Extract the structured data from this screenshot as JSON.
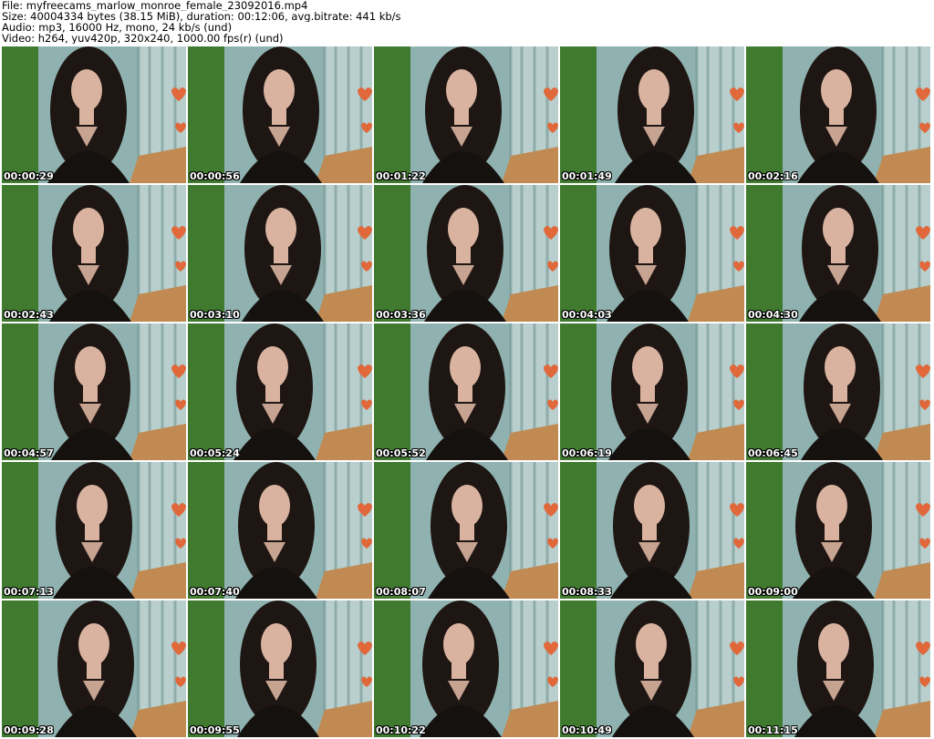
{
  "header": {
    "file_line": "File: myfreecams_marlow_monroe_female_23092016.mp4",
    "size_line": "Size: 40004334 bytes (38.15 MiB), duration: 00:12:06, avg.bitrate: 441 kb/s",
    "audio_line": "Audio: mp3, 16000 Hz, mono, 24 kb/s (und)",
    "video_line": "Video: h264, yuv420p, 320x240, 1000.00 fps(r) (und)"
  },
  "thumbnails": [
    {
      "timestamp": "00:00:29"
    },
    {
      "timestamp": "00:00:56"
    },
    {
      "timestamp": "00:01:22"
    },
    {
      "timestamp": "00:01:49"
    },
    {
      "timestamp": "00:02:16"
    },
    {
      "timestamp": "00:02:43"
    },
    {
      "timestamp": "00:03:10"
    },
    {
      "timestamp": "00:03:36"
    },
    {
      "timestamp": "00:04:03"
    },
    {
      "timestamp": "00:04:30"
    },
    {
      "timestamp": "00:04:57"
    },
    {
      "timestamp": "00:05:24"
    },
    {
      "timestamp": "00:05:52"
    },
    {
      "timestamp": "00:06:19"
    },
    {
      "timestamp": "00:06:45"
    },
    {
      "timestamp": "00:07:13"
    },
    {
      "timestamp": "00:07:40"
    },
    {
      "timestamp": "00:08:07"
    },
    {
      "timestamp": "00:08:33"
    },
    {
      "timestamp": "00:09:00"
    },
    {
      "timestamp": "00:09:28"
    },
    {
      "timestamp": "00:09:55"
    },
    {
      "timestamp": "00:10:22"
    },
    {
      "timestamp": "00:10:49"
    },
    {
      "timestamp": "00:11:15"
    }
  ],
  "colors": {
    "curtain": "#8fb2b0",
    "green_wall": "#3f7a2f",
    "hair": "#1e1612",
    "skin": "#d9b3a0",
    "desk": "#c08a52",
    "heart": "#e0683a"
  }
}
